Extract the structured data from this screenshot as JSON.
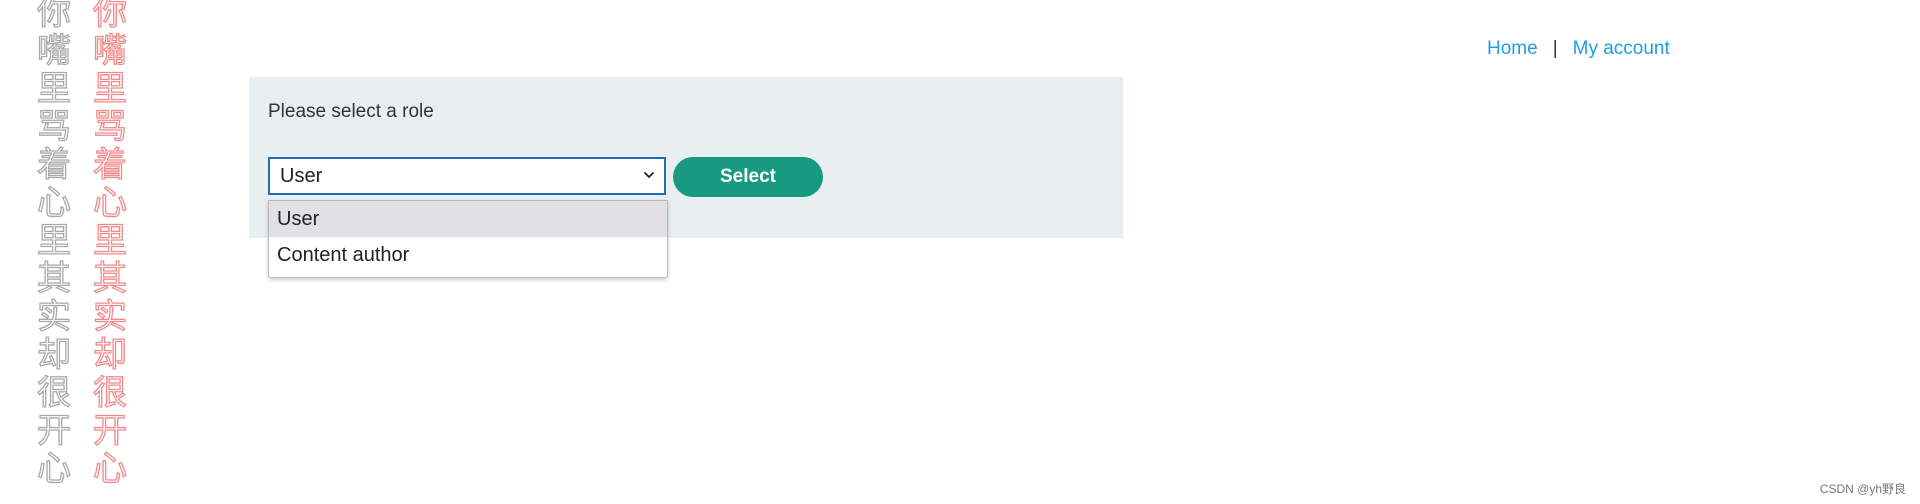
{
  "watermark": {
    "column_gray": [
      "你",
      "嘴",
      "里",
      "骂",
      "着",
      "心",
      "里",
      "其",
      "实",
      "却",
      "很",
      "开",
      "心"
    ],
    "column_red": [
      "你",
      "嘴",
      "里",
      "骂",
      "着",
      "心",
      "里",
      "其",
      "实",
      "却",
      "很",
      "开",
      "心"
    ]
  },
  "nav": {
    "home": "Home",
    "separator": "|",
    "my_account": "My account",
    "link_color": "#1e9fd6"
  },
  "role_form": {
    "title": "Please select a role",
    "selected_value": "User",
    "options": [
      "User",
      "Content author"
    ],
    "button_label": "Select",
    "button_color": "#179a80",
    "panel_color": "#e9eef1"
  },
  "credit": "CSDN @yh野良"
}
